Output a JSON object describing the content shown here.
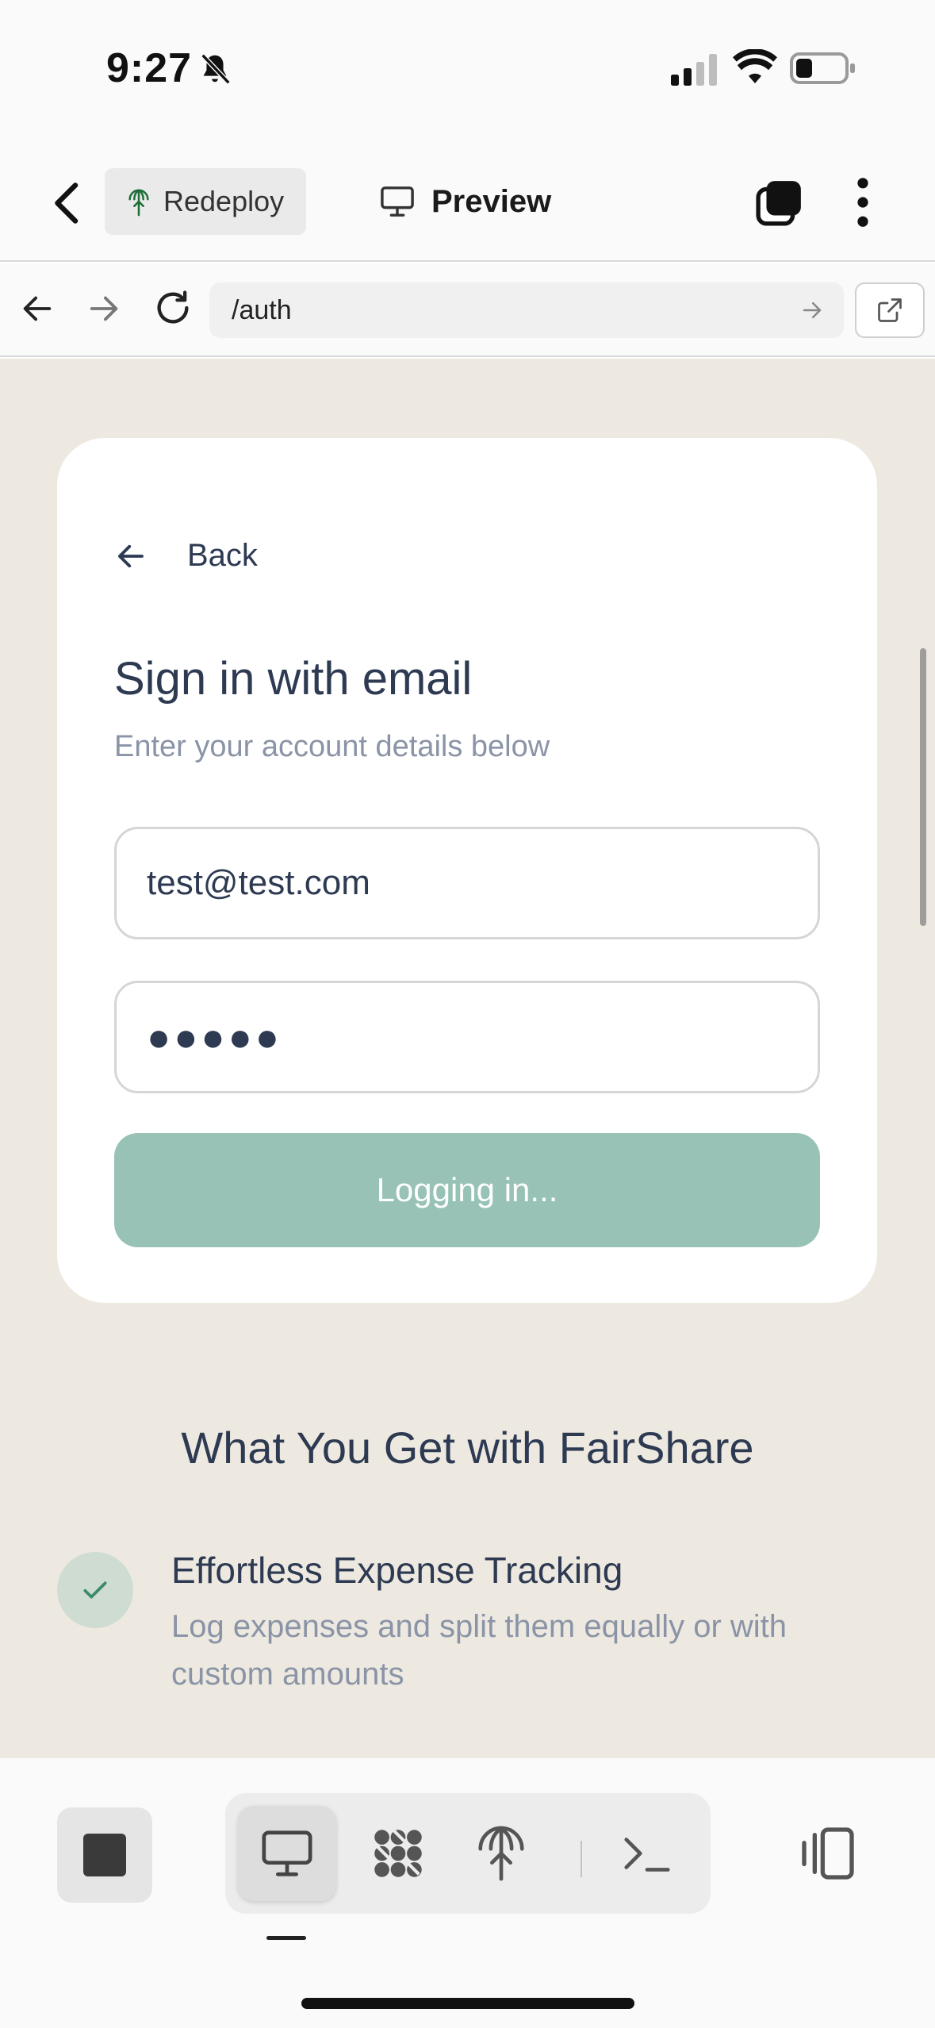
{
  "status_bar": {
    "time": "9:27"
  },
  "toolbar": {
    "redeploy_label": "Redeploy",
    "preview_label": "Preview"
  },
  "browser": {
    "url": "/auth"
  },
  "auth_card": {
    "back_label": "Back",
    "title": "Sign in with email",
    "subtitle": "Enter your account details below",
    "email_value": "test@test.com",
    "password_mask": "●●●●●",
    "submit_label": "Logging in..."
  },
  "features": {
    "heading": "What You Get with FairShare",
    "items": [
      {
        "title": "Effortless Expense Tracking",
        "description": "Log expenses and split them equally or with custom amounts"
      }
    ]
  },
  "colors": {
    "accent_button": "#97c2b5",
    "page_background": "#ede9e0",
    "text_primary": "#2d3a52",
    "text_muted": "#8a94a6"
  }
}
